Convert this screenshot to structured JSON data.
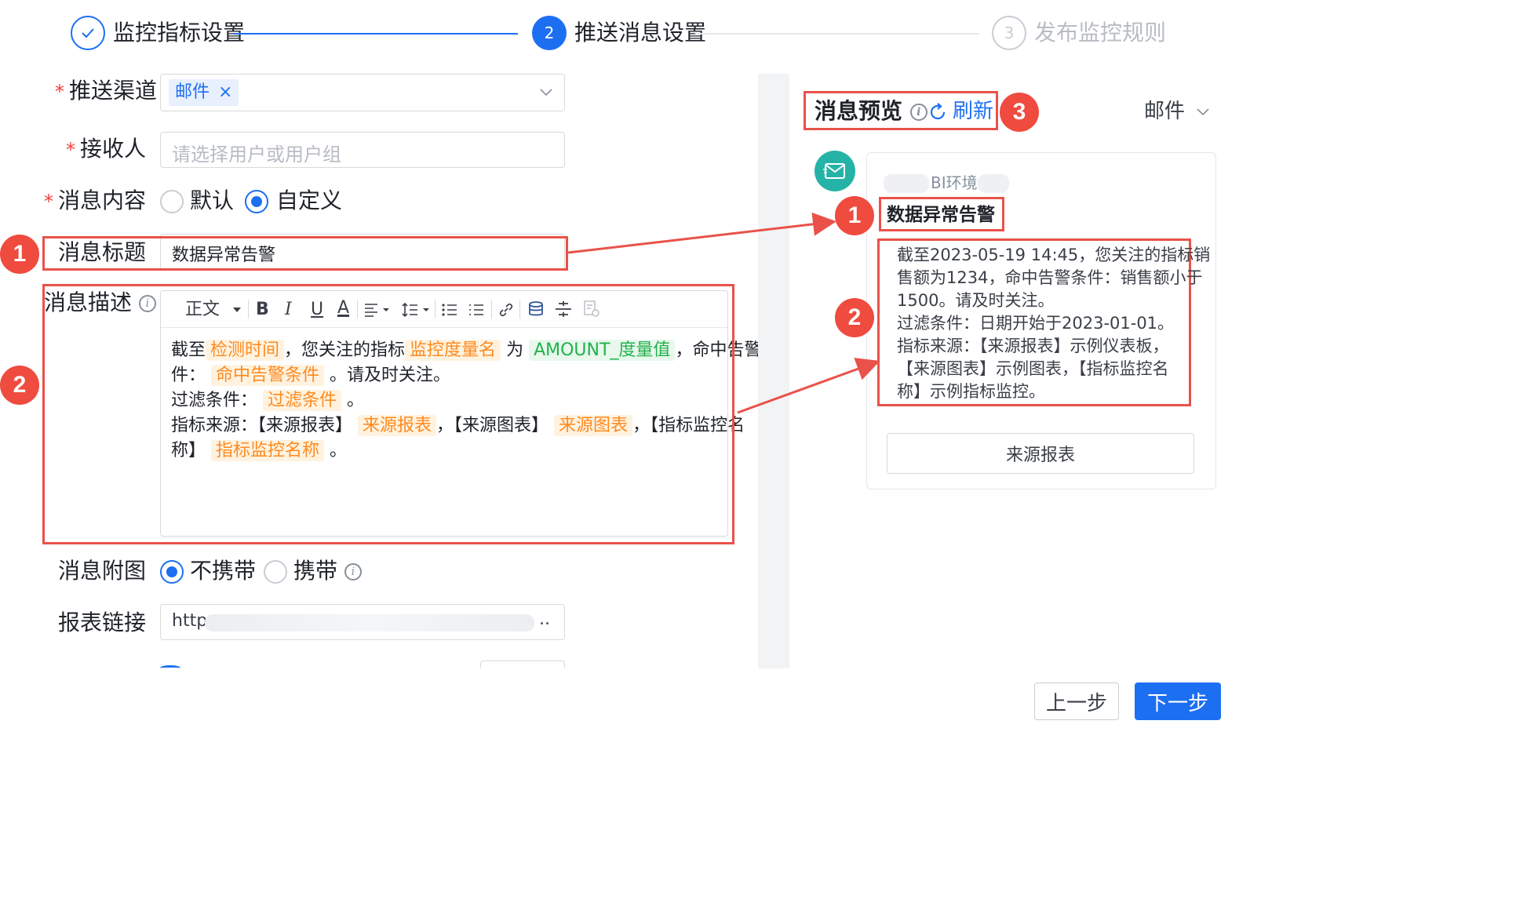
{
  "steps": [
    {
      "label": "监控指标设置",
      "number": "1",
      "state": "done"
    },
    {
      "label": "推送消息设置",
      "number": "2",
      "state": "active"
    },
    {
      "label": "发布监控规则",
      "number": "3",
      "state": "pending"
    }
  ],
  "form": {
    "channel": {
      "label": "推送渠道",
      "tag": "邮件",
      "tag_close": "×"
    },
    "recipient": {
      "label": "接收人",
      "placeholder": "请选择用户或用户组"
    },
    "content": {
      "label": "消息内容",
      "option_default": "默认",
      "option_custom": "自定义",
      "selected": "自定义"
    },
    "title": {
      "label": "消息标题",
      "value": "数据异常告警"
    },
    "description": {
      "label": "消息描述"
    },
    "attachment": {
      "label": "消息附图",
      "option_none": "不携带",
      "option_with": "携带",
      "selected": "不携带"
    },
    "report_link": {
      "label": "报表链接",
      "value": "http",
      "suffix": ".."
    }
  },
  "editor": {
    "toolbar": {
      "paragraph": "正文",
      "bold": "B",
      "italic": "I",
      "underline": "U",
      "color": "A"
    },
    "content": {
      "l1_a": "截至",
      "l1_t1": "检测时间",
      "l1_b": "，您关注的指标",
      "l1_t2": "监控度量名",
      "l1_c": "为",
      "l1_t3": "AMOUNT_度量值",
      "l1_d": "，命中告警条",
      "l2_a": "件：",
      "l2_t1": "命中告警条件",
      "l2_b": "。请及时关注。",
      "l3_a": "过滤条件：",
      "l3_t1": "过滤条件",
      "l3_b": "。",
      "l4_a": "指标来源：【来源报表】",
      "l4_t1": "来源报表",
      "l4_b": "，【来源图表】",
      "l4_t2": "来源图表",
      "l4_c": "，【指标监控名",
      "l5_a": "称】",
      "l5_t1": "指标监控名称",
      "l5_b": "。"
    }
  },
  "preview": {
    "title": "消息预览",
    "refresh": "刷新",
    "channel": "邮件",
    "env": "BI环境",
    "msg_title": "数据异常告警",
    "body_lines": [
      "截至2023-05-19 14:45，您关注的指标销",
      "售额为1234，命中告警条件：销售额小于",
      "1500。请及时关注。",
      "过滤条件：日期开始于2023-01-01。",
      "指标来源：【来源报表】示例仪表板，",
      "【来源图表】示例图表，【指标监控名",
      "称】示例指标监控。"
    ],
    "button": "来源报表"
  },
  "annotations": {
    "one": "1",
    "two": "2",
    "three": "3"
  },
  "footer": {
    "prev": "上一步",
    "next": "下一步"
  },
  "colors": {
    "primary": "#1d6ff2",
    "annotation": "#e9524a",
    "tag_orange": "#ff8a1f",
    "tag_green": "#22b14c",
    "mail_icon": "#26b3a7"
  }
}
